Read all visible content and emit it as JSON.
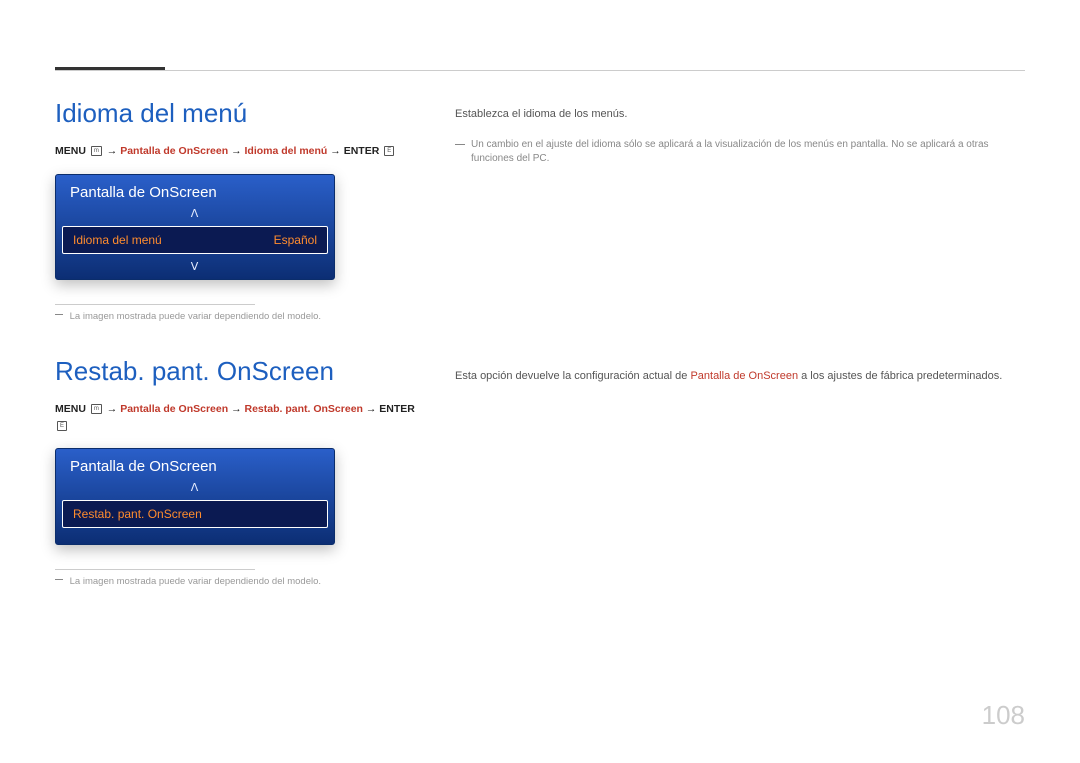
{
  "page_number": "108",
  "sections": [
    {
      "title": "Idioma del menú",
      "breadcrumb": {
        "prefix": "MENU",
        "menu_icon": "m",
        "parts": [
          "Pantalla de OnScreen",
          "Idioma del menú"
        ],
        "suffix": "ENTER",
        "enter_icon": "E"
      },
      "osd": {
        "header": "Pantalla de OnScreen",
        "arrow_up": true,
        "arrow_down": true,
        "item_label": "Idioma del menú",
        "item_value": "Español"
      },
      "footnote": "La imagen mostrada puede variar dependiendo del modelo.",
      "right_text": "Establezca el idioma de los menús.",
      "right_note": "Un cambio en el ajuste del idioma sólo se aplicará a la visualización de los menús en pantalla. No se aplicará a otras funciones del PC."
    },
    {
      "title": "Restab. pant. OnScreen",
      "breadcrumb": {
        "prefix": "MENU",
        "menu_icon": "m",
        "parts": [
          "Pantalla de OnScreen",
          "Restab. pant. OnScreen"
        ],
        "suffix": "ENTER",
        "enter_icon": "E"
      },
      "osd": {
        "header": "Pantalla de OnScreen",
        "arrow_up": true,
        "arrow_down": false,
        "item_label": "Restab. pant. OnScreen",
        "item_value": ""
      },
      "footnote": "La imagen mostrada puede variar dependiendo del modelo.",
      "right_text_before": "Esta opción devuelve la configuración actual de ",
      "right_text_highlight": "Pantalla de OnScreen",
      "right_text_after": " a los ajustes de fábrica predeterminados."
    }
  ]
}
